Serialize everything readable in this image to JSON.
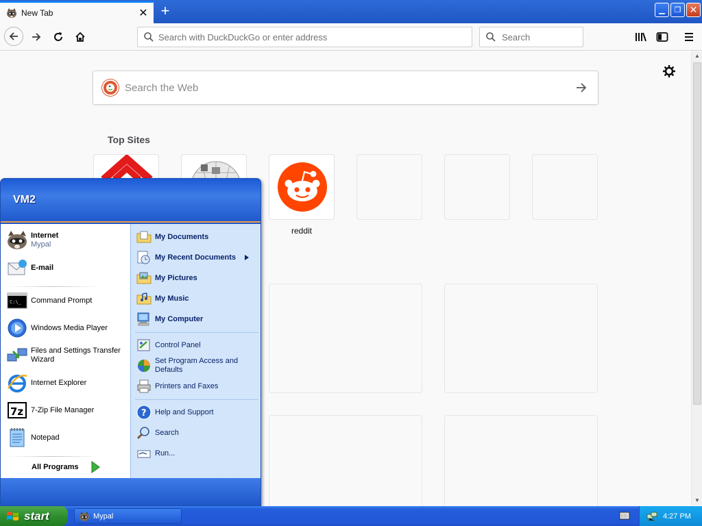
{
  "browser": {
    "tab_title": "New Tab",
    "url_placeholder": "Search with DuckDuckGo or enter address",
    "search_placeholder": "Search"
  },
  "newtab": {
    "search_placeholder": "Search the Web",
    "top_sites_title": "Top Sites",
    "tiles": [
      {
        "label": "",
        "icon": "red-chevrons-logo"
      },
      {
        "label": "",
        "icon": "wikipedia-globe-logo"
      },
      {
        "label": "reddit",
        "icon": "reddit-logo"
      }
    ]
  },
  "start_menu": {
    "user_name": "VM2",
    "pinned": [
      {
        "title": "Internet",
        "subtitle": "Mypal",
        "icon": "mypal-raccoon-icon"
      },
      {
        "title": "E-mail",
        "icon": "email-icon"
      }
    ],
    "recent": [
      {
        "label": "Command Prompt",
        "icon": "command-prompt-icon"
      },
      {
        "label": "Windows Media Player",
        "icon": "media-player-icon"
      },
      {
        "label": "Files and Settings Transfer Wizard",
        "icon": "transfer-wizard-icon"
      },
      {
        "label": "Internet Explorer",
        "icon": "internet-explorer-icon"
      },
      {
        "label": "7-Zip File Manager",
        "icon": "7zip-icon"
      },
      {
        "label": "Notepad",
        "icon": "notepad-icon"
      }
    ],
    "all_programs": "All Programs",
    "places": [
      {
        "label": "My Documents",
        "icon": "folder-documents-icon"
      },
      {
        "label": "My Recent Documents",
        "icon": "recent-documents-icon"
      },
      {
        "label": "My Pictures",
        "icon": "folder-pictures-icon"
      },
      {
        "label": "My Music",
        "icon": "folder-music-icon"
      },
      {
        "label": "My Computer",
        "icon": "computer-icon"
      }
    ],
    "settings": [
      {
        "label": "Control Panel",
        "icon": "control-panel-icon"
      },
      {
        "label": "Set Program Access and Defaults",
        "icon": "program-defaults-icon"
      },
      {
        "label": "Printers and Faxes",
        "icon": "printer-icon"
      }
    ],
    "help": [
      {
        "label": "Help and Support",
        "icon": "help-icon"
      },
      {
        "label": "Search",
        "icon": "search-icon"
      },
      {
        "label": "Run...",
        "icon": "run-icon"
      }
    ]
  },
  "taskbar": {
    "start_label": "start",
    "task_label": "Mypal",
    "clock": "4:27 PM"
  },
  "colors": {
    "xp_blue": "#245edb",
    "start_green": "#2f8f2f",
    "firefox_accent": "#0a84ff",
    "reddit_orange": "#ff4500",
    "ddg_orange": "#de5833"
  }
}
